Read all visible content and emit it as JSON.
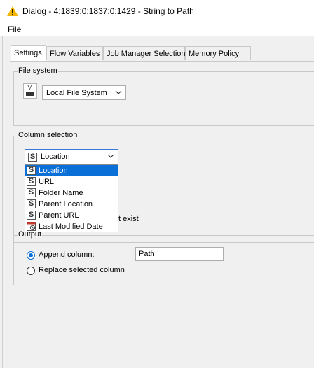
{
  "window": {
    "title": "Dialog - 4:1839:0:1837:0:1429 - String to Path"
  },
  "menu": {
    "file": "File"
  },
  "tabs": [
    {
      "label": "Settings",
      "active": true
    },
    {
      "label": "Flow Variables"
    },
    {
      "label": "Job Manager Selection"
    },
    {
      "label": "Memory Policy"
    }
  ],
  "file_system": {
    "group_label": "File system",
    "icon_letter": "V",
    "selected": "Local File System"
  },
  "column_selection": {
    "group_label": "Column selection",
    "selected": "Location",
    "options": [
      {
        "label": "Location",
        "type": "S",
        "selected": true
      },
      {
        "label": "URL",
        "type": "S"
      },
      {
        "label": "Folder Name",
        "type": "S"
      },
      {
        "label": "Parent Location",
        "type": "S"
      },
      {
        "label": "Parent URL",
        "type": "S"
      },
      {
        "label": "Last Modified Date",
        "type": "date"
      }
    ],
    "partially_hidden_text": "t exist"
  },
  "output": {
    "group_label": "Output",
    "append_label": "Append column:",
    "append_value": "Path",
    "replace_label": "Replace selected column",
    "selected_mode": "append"
  },
  "colors": {
    "accent": "#0a6fd6",
    "warning": "#f2b705"
  },
  "icons": {
    "title": "warning-triangle-icon"
  }
}
